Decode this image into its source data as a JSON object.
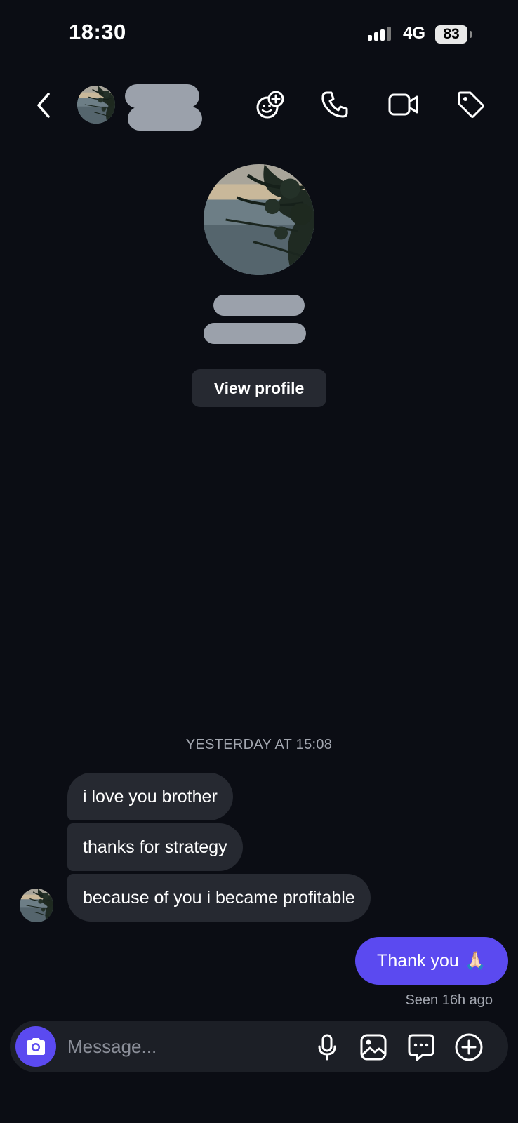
{
  "status_bar": {
    "time": "18:30",
    "network": "4G",
    "battery": "83"
  },
  "header": {
    "back_icon": "chevron-left-icon",
    "actions": [
      "sticker-add-icon",
      "phone-icon",
      "video-icon",
      "tag-icon"
    ]
  },
  "profile": {
    "view_profile_label": "View profile"
  },
  "conversation": {
    "timestamp": "YESTERDAY AT 15:08",
    "incoming": [
      "i love you brother",
      "thanks for strategy",
      "because of you i became profitable"
    ],
    "outgoing": {
      "text": "Thank you",
      "emoji": "🙏🏻"
    },
    "seen": "Seen 16h ago"
  },
  "composer": {
    "placeholder": "Message...",
    "icons": [
      "camera-icon",
      "microphone-icon",
      "image-icon",
      "sticker-icon",
      "plus-icon"
    ]
  },
  "colors": {
    "background": "#0b0d14",
    "bubble_in": "#262931",
    "accent": "#5b4af0"
  }
}
